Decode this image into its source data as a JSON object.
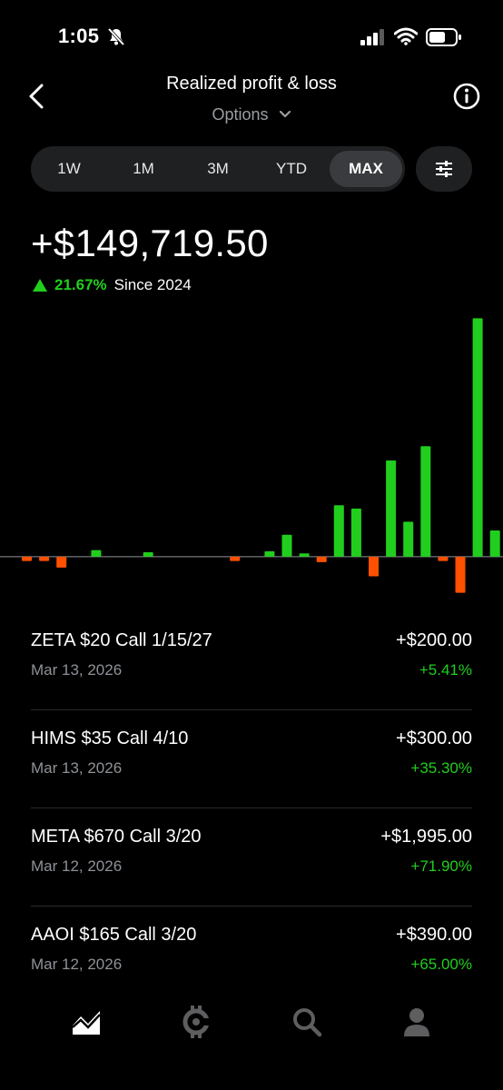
{
  "status_bar": {
    "time": "1:05"
  },
  "header": {
    "title": "Realized profit & loss",
    "subtitle": "Options",
    "icons": {
      "back": "chevron-left-icon",
      "info": "info-icon",
      "dropdown": "chevron-down-icon"
    }
  },
  "range_selector": {
    "tabs": [
      {
        "label": "1W",
        "active": false
      },
      {
        "label": "1M",
        "active": false
      },
      {
        "label": "3M",
        "active": false
      },
      {
        "label": "YTD",
        "active": false
      },
      {
        "label": "MAX",
        "active": true
      }
    ],
    "filter_icon": "sliders-icon"
  },
  "summary": {
    "total": "+$149,719.50",
    "change_pct": "21.67%",
    "since": "Since 2024"
  },
  "colors": {
    "gain": "#21ce1d",
    "loss": "#ff5000",
    "background": "#000000",
    "muted": "#8e9297"
  },
  "chart_data": {
    "type": "bar",
    "ylim": [
      -35,
      220
    ],
    "values": [
      -4,
      -4,
      -10,
      0,
      6,
      0,
      0,
      4,
      0,
      0,
      0,
      0,
      -4,
      0,
      5,
      20,
      3,
      -5,
      47,
      44,
      -18,
      88,
      32,
      101,
      -4,
      -33,
      218,
      24
    ]
  },
  "trades": [
    {
      "name": "ZETA $20 Call 1/15/27",
      "date": "Mar 13, 2026",
      "amount": "+$200.00",
      "pct": "+5.41%"
    },
    {
      "name": "HIMS $35 Call 4/10",
      "date": "Mar 13, 2026",
      "amount": "+$300.00",
      "pct": "+35.30%"
    },
    {
      "name": "META $670 Call 3/20",
      "date": "Mar 12, 2026",
      "amount": "+$1,995.00",
      "pct": "+71.90%"
    },
    {
      "name": "AAOI $165 Call 3/20",
      "date": "Mar 12, 2026",
      "amount": "+$390.00",
      "pct": "+65.00%"
    }
  ],
  "bottom_nav": [
    {
      "icon": "chart-icon",
      "active": true
    },
    {
      "icon": "crypto-icon",
      "active": false
    },
    {
      "icon": "search-icon",
      "active": false
    },
    {
      "icon": "account-icon",
      "active": false
    }
  ]
}
